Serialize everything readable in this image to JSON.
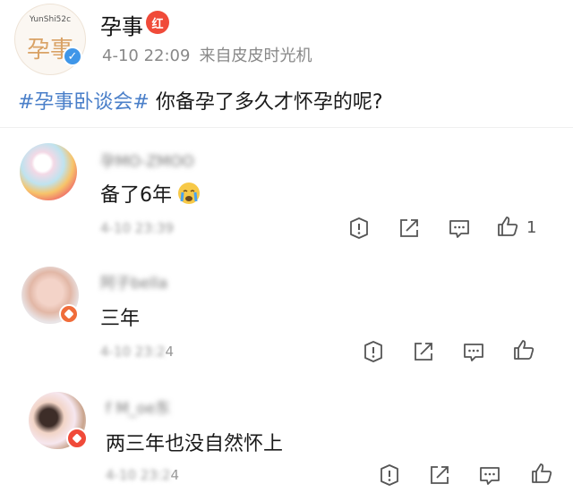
{
  "post": {
    "author": "孕事",
    "author_tag": "红",
    "avatar_logo_top": "YunShi52c",
    "avatar_logo_mid": "孕事",
    "date": "4-10 22:09",
    "source": "来自皮皮时光机",
    "topic": "#孕事卧谈会#",
    "question": " 你备孕了多久才怀孕的呢?"
  },
  "comments": [
    {
      "username": "孕MO-ZMOO",
      "text": "备了6年",
      "emoji": "crying-face",
      "time": "4-10 23:39",
      "like_count": "1"
    },
    {
      "username": "阿子bella",
      "text": "三年",
      "time_blur": "4-10 23:2",
      "time_tail": "4"
    },
    {
      "username": "f M_oe东",
      "text": "两三年也没自然怀上",
      "time_blur": "4-10 23:2",
      "time_tail": "4"
    }
  ],
  "icons": {
    "report": "alert-circle-icon",
    "share": "share-icon",
    "comment": "comment-icon",
    "like": "thumbs-up-icon"
  },
  "colors": {
    "topic": "#4a7fc9",
    "verified": "#3f96e8",
    "tag_red": "#f04a39",
    "meta_gray": "#888888",
    "icon_gray": "#555555"
  }
}
